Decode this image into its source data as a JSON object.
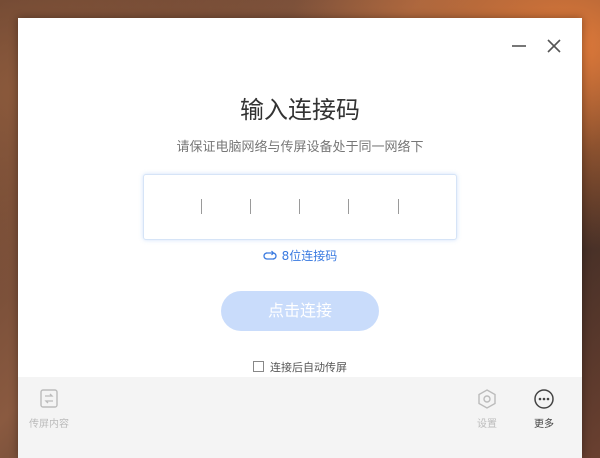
{
  "window": {
    "minimize_icon": "minimize-icon",
    "close_icon": "close-icon"
  },
  "main": {
    "title": "输入连接码",
    "subtitle": "请保证电脑网络与传屏设备处于同一网络下",
    "code_slots": 5,
    "switch_link": "8位连接码",
    "connect_button": "点击连接",
    "auto_cast_label": "连接后自动传屏",
    "auto_cast_checked": false
  },
  "footer": {
    "cast_content": "传屏内容",
    "settings": "设置",
    "more": "更多"
  },
  "colors": {
    "accent": "#3a7ae0",
    "button_disabled": "#c9dcfb",
    "footer_bg": "#f4f4f4"
  }
}
